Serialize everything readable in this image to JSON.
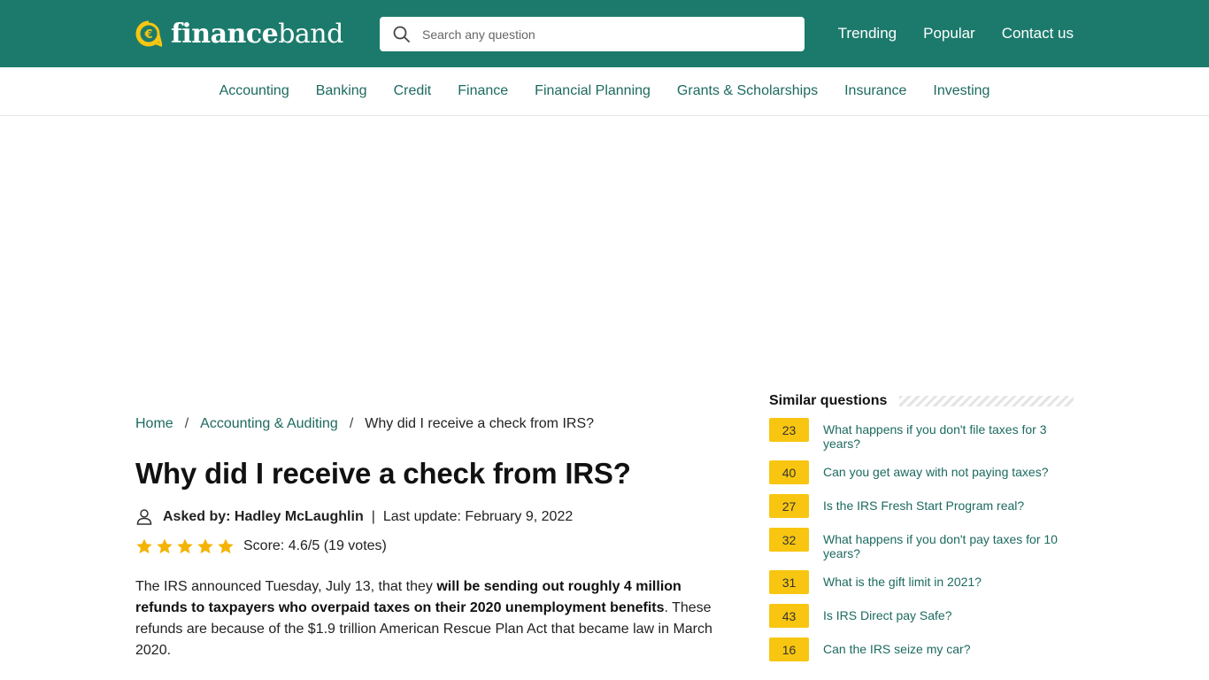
{
  "brand": {
    "name_bold": "finance",
    "name_light": "band"
  },
  "search": {
    "placeholder": "Search any question"
  },
  "topnav": [
    {
      "label": "Trending"
    },
    {
      "label": "Popular"
    },
    {
      "label": "Contact us"
    }
  ],
  "categories": [
    {
      "label": "Accounting"
    },
    {
      "label": "Banking"
    },
    {
      "label": "Credit"
    },
    {
      "label": "Finance"
    },
    {
      "label": "Financial Planning"
    },
    {
      "label": "Grants & Scholarships"
    },
    {
      "label": "Insurance"
    },
    {
      "label": "Investing"
    }
  ],
  "breadcrumb": {
    "home": "Home",
    "category": "Accounting & Auditing",
    "current": "Why did I receive a check from IRS?",
    "separator": "/"
  },
  "question": {
    "title": "Why did I receive a check from IRS?",
    "asked_by_label": "Asked by: Hadley McLaughlin",
    "pipe": "|",
    "last_update": "Last update: February 9, 2022",
    "rating_value": 4.6,
    "score_text": "Score: 4.6/5 (19 votes)"
  },
  "article": {
    "part1": "The IRS announced Tuesday, July 13, that they ",
    "bold": "will be sending out roughly 4 million refunds to taxpayers who overpaid taxes on their 2020 unemployment benefits",
    "part2": ". These refunds are because of the $1.9 trillion American Rescue Plan Act that became law in March 2020."
  },
  "similar": {
    "title": "Similar questions",
    "items": [
      {
        "count": "23",
        "text": "What happens if you don't file taxes for 3 years?"
      },
      {
        "count": "40",
        "text": "Can you get away with not paying taxes?"
      },
      {
        "count": "27",
        "text": "Is the IRS Fresh Start Program real?"
      },
      {
        "count": "32",
        "text": "What happens if you don't pay taxes for 10 years?"
      },
      {
        "count": "31",
        "text": "What is the gift limit in 2021?"
      },
      {
        "count": "43",
        "text": "Is IRS Direct pay Safe?"
      },
      {
        "count": "16",
        "text": "Can the IRS seize my car?"
      }
    ]
  },
  "colors": {
    "header_bg": "#1c7a6c",
    "link": "#1c6a60",
    "badge": "#f8c611",
    "star": "#f5b301"
  }
}
